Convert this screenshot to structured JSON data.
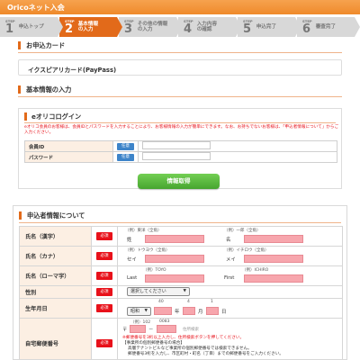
{
  "header": {
    "title": "Oricoネット入会"
  },
  "steps": [
    {
      "word": "STEP",
      "num": "1",
      "label": "申込トップ",
      "active": false
    },
    {
      "word": "STEP",
      "num": "2",
      "label": "基本情報\nの入力",
      "active": true
    },
    {
      "word": "STEP",
      "num": "3",
      "label": "その他の情報\nの入力",
      "active": false
    },
    {
      "word": "STEP",
      "num": "4",
      "label": "入力内容\nの確認",
      "active": false
    },
    {
      "word": "STEP",
      "num": "5",
      "label": "申込完了",
      "active": false
    },
    {
      "word": "STEP",
      "num": "6",
      "label": "審査完了",
      "active": false
    }
  ],
  "card_section": {
    "heading": "お申込カード",
    "card_name": "イクスピアリカード(PayPass)"
  },
  "basic_section": {
    "heading": "基本情報の入力"
  },
  "login": {
    "title": "eオリコログイン",
    "note": "eオリコ会員のお客様は、会員IDとパスワードを入力することにより、お客様情報の入力が簡単にできます。なお、お持ちでないお客様は、「申込者情報について」からご入力ください。",
    "rows": [
      {
        "label": "会員ID",
        "badge": "任意"
      },
      {
        "label": "パスワード",
        "badge": "任意"
      }
    ],
    "button": "情報取得"
  },
  "applicant": {
    "title": "申込者情報について",
    "required_badge": "必須",
    "name_kanji": {
      "label": "氏名（漢字）",
      "sei_hint": "（例）東洋（全角）",
      "sei_label": "姓",
      "mei_hint": "（例）一郎（全角）",
      "mei_label": "名"
    },
    "name_kana": {
      "label": "氏名（カナ）",
      "sei_hint": "（例）トウヨウ（全角）",
      "sei_label": "セイ",
      "mei_hint": "（例）イチロウ（全角）",
      "mei_label": "メイ"
    },
    "name_roma": {
      "label": "氏名（ローマ字）",
      "sei_hint": "（例）TOYO",
      "sei_label": "Last",
      "mei_hint": "（例）ICHIRO",
      "mei_label": "First"
    },
    "gender": {
      "label": "性別",
      "select": "選択してください"
    },
    "birthday": {
      "label": "生年月日",
      "era": "昭和",
      "year_hint": "40",
      "month_hint": "4",
      "day_hint": "1",
      "year_label": "年",
      "month_label": "月",
      "day_label": "日"
    },
    "postal": {
      "label": "自宅郵便番号",
      "hint1": "（例）102",
      "hint2": "0083",
      "prefix": "〒",
      "dash": "－",
      "search_hint": "住所検索",
      "warning": "※郵便番号を3桁以上入力し、住所検索ボタンを押してください。",
      "notes": [
        "【事業所の個別郵便番号の場合】",
        "高層テナントビルなど事業所の個別郵便番号では検索できません。",
        "郵便番号3桁を入力し、市区町村・町名（丁目）までの郵便番号をご入力ください。"
      ]
    }
  },
  "colors": {
    "accent": "#e26a1a",
    "header": "#ef8a2b",
    "required": "#e8111a",
    "optional": "#3d84c9",
    "input_highlight": "#f7a6ad",
    "button": "#46a52f"
  }
}
